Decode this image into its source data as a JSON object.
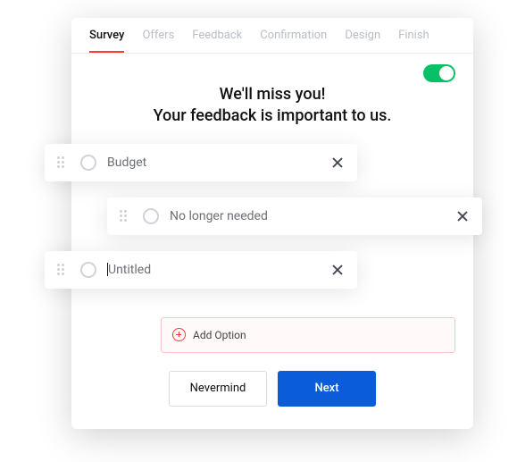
{
  "tabs": {
    "items": [
      {
        "label": "Survey",
        "active": true
      },
      {
        "label": "Offers",
        "active": false
      },
      {
        "label": "Feedback",
        "active": false
      },
      {
        "label": "Confirmation",
        "active": false
      },
      {
        "label": "Design",
        "active": false
      },
      {
        "label": "Finish",
        "active": false
      }
    ]
  },
  "toggle": {
    "state": "on"
  },
  "heading": {
    "line1": "We'll miss you!",
    "line2": "Your feedback is important to us."
  },
  "options": [
    {
      "label": "Budget"
    },
    {
      "label": "No longer needed"
    },
    {
      "label": "Untitled",
      "editing": true
    }
  ],
  "add_option": {
    "label": "Add Option"
  },
  "actions": {
    "secondary": "Nevermind",
    "primary": "Next"
  },
  "colors": {
    "accent_red": "#ff3b30",
    "toggle_green": "#06c167",
    "primary_blue": "#0b5cd8"
  }
}
